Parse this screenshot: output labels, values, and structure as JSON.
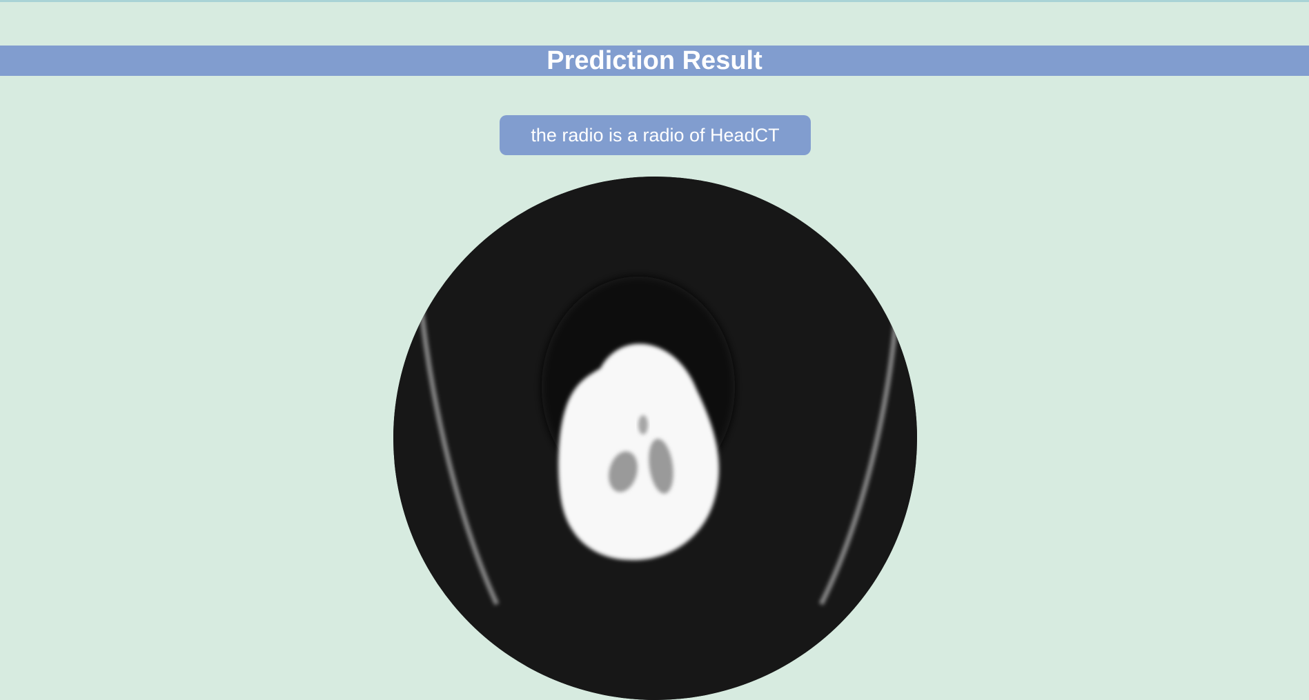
{
  "header": {
    "title": "Prediction Result"
  },
  "result": {
    "text": "the radio is a radio of HeadCT"
  },
  "scan": {
    "icon": "headct-scan-image",
    "background_color": "#171717"
  },
  "colors": {
    "page_background": "#d7ebe0",
    "accent": "#819dcf",
    "text_on_accent": "#ffffff"
  }
}
